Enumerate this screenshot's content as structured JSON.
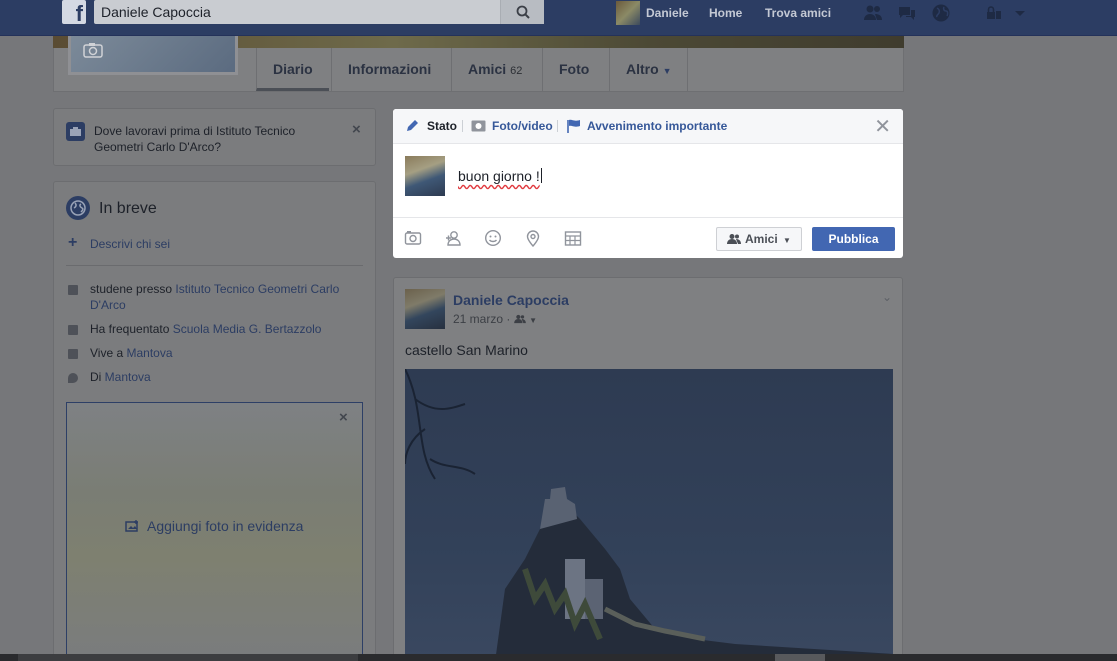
{
  "topbar": {
    "logo": "f",
    "search_value": "Daniele Capoccia",
    "user_name": "Daniele",
    "home_label": "Home",
    "find_friends_label": "Trova amici"
  },
  "tabs": [
    {
      "label": "Diario"
    },
    {
      "label": "Informazioni"
    },
    {
      "label": "Amici",
      "count": "62"
    },
    {
      "label": "Foto"
    },
    {
      "label": "Altro"
    }
  ],
  "work_prompt": {
    "text": "Dove lavoravi prima di Istituto Tecnico Geometri Carlo D'Arco?"
  },
  "intro": {
    "title": "In breve",
    "describe_label": "Descrivi chi sei",
    "rows": [
      {
        "prefix": "studene presso ",
        "link": "Istituto Tecnico Geometri Carlo D'Arco"
      },
      {
        "prefix": "Ha frequentato ",
        "link": "Scuola Media G. Bertazzolo"
      },
      {
        "prefix": "Vive a ",
        "link": "Mantova"
      },
      {
        "prefix": "Di ",
        "link": "Mantova"
      }
    ],
    "featured_label": "Aggiungi foto in evidenza"
  },
  "composer": {
    "tab_status": "Stato",
    "tab_photo": "Foto/video",
    "tab_event": "Avvenimento importante",
    "text": "buon giorno !",
    "audience_label": "Amici",
    "publish_label": "Pubblica"
  },
  "post": {
    "author": "Daniele Capoccia",
    "date": "21 marzo",
    "text": "castello San Marino"
  },
  "colors": {
    "brand": "#3b5998",
    "publish": "#4267b2"
  }
}
